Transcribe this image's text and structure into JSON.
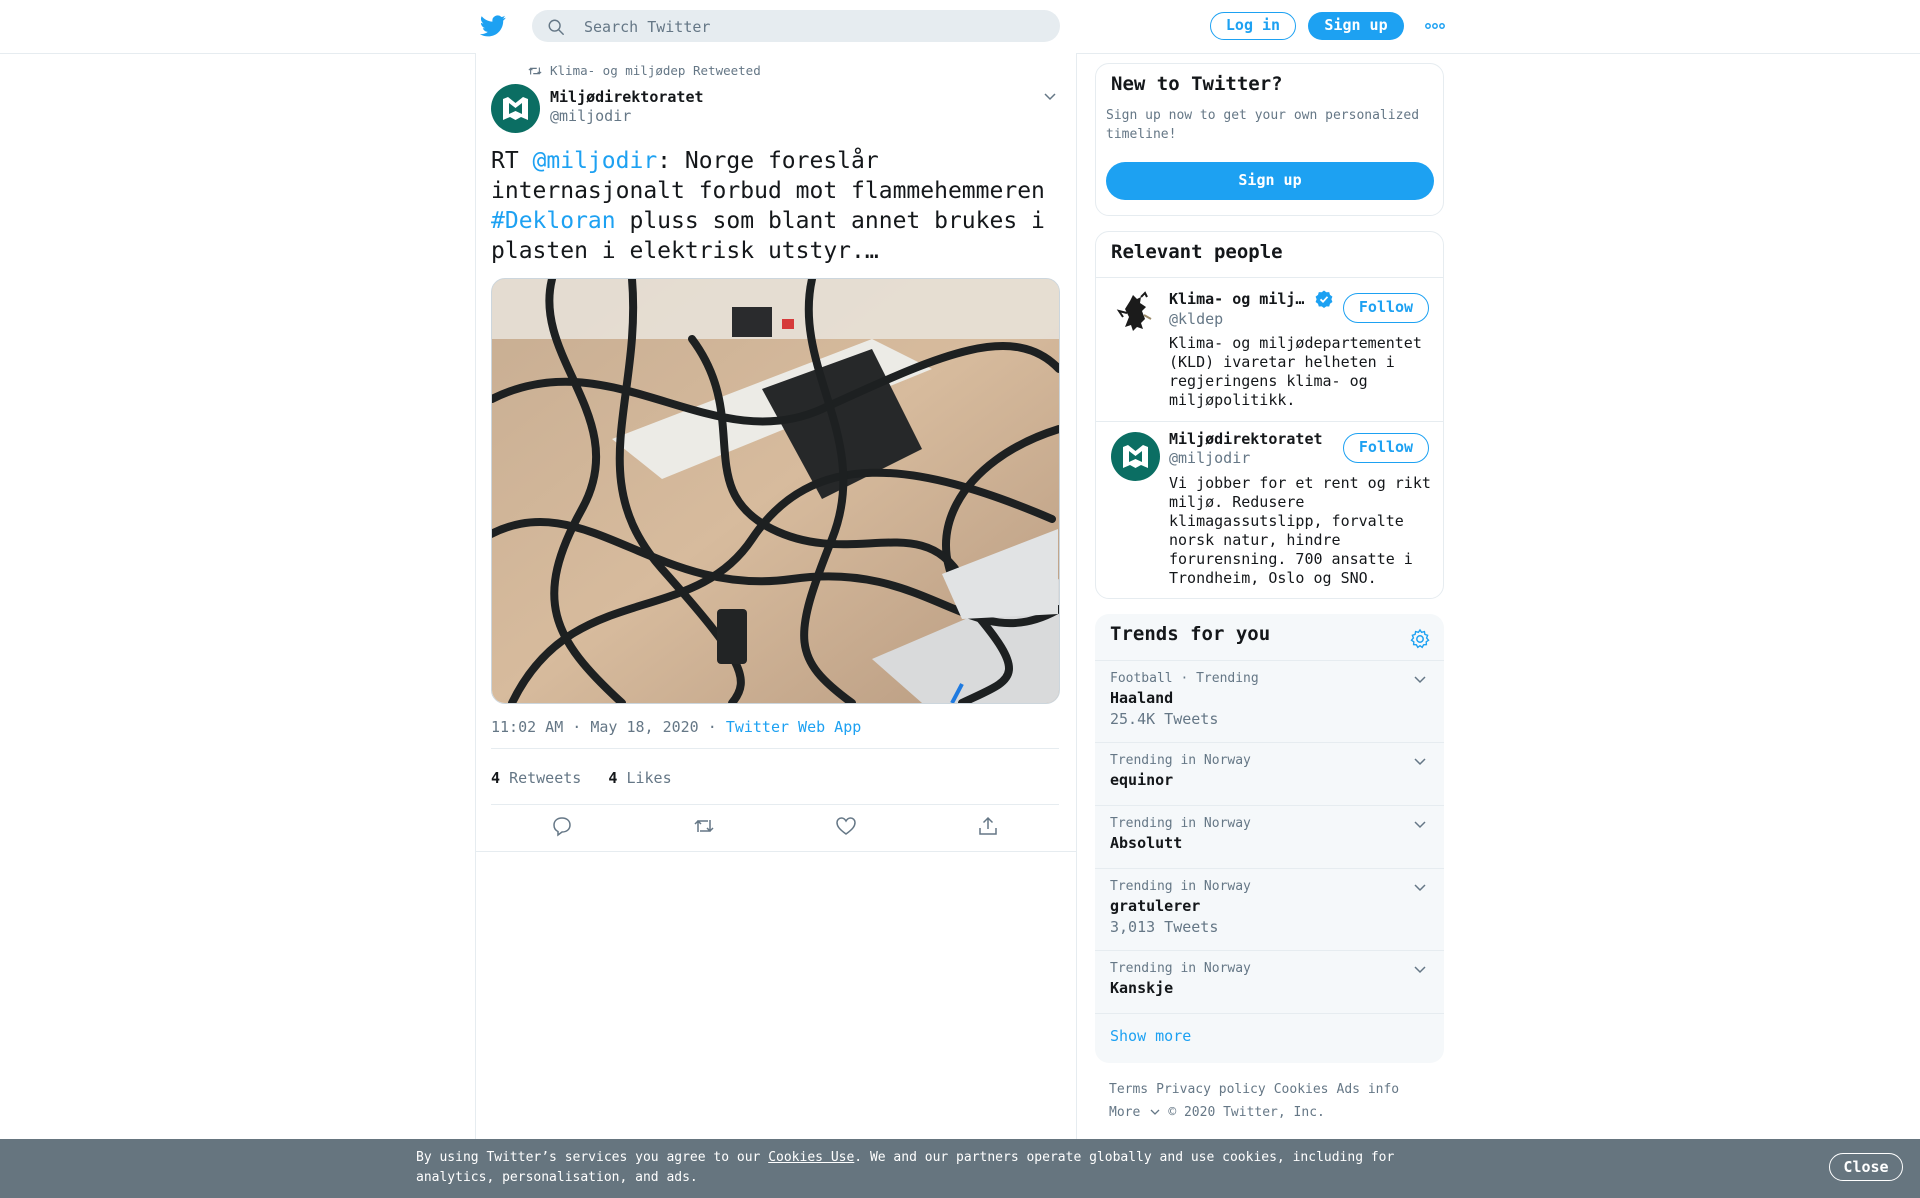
{
  "header": {
    "search_placeholder": "Search Twitter",
    "login_label": "Log in",
    "signup_label": "Sign up",
    "brand_color": "#1da1f2"
  },
  "tweet": {
    "retweeted_by": "Klima- og miljødep Retweeted",
    "author_name": "Miljødirektoratet",
    "author_handle": "@miljodir",
    "text_parts": {
      "prefix": "RT ",
      "mention": "@miljodir",
      "middle": ": Norge foreslår internasjonalt forbud mot flammehemmeren ",
      "hashtag": "#Dekloran",
      "suffix": " pluss som blant annet brukes i plasten i elektrisk utstyr.…"
    },
    "timestamp": "11:02 AM · May 18, 2020",
    "separator": "·",
    "source": "Twitter Web App",
    "retweet_count": "4",
    "retweets_label": "Retweets",
    "like_count": "4",
    "likes_label": "Likes",
    "actions": [
      "reply-icon",
      "retweet-icon",
      "like-icon",
      "share-icon"
    ]
  },
  "new_to_twitter": {
    "title": "New to Twitter?",
    "subtitle": "Sign up now to get your own personalized timeline!",
    "button": "Sign up"
  },
  "relevant_people": {
    "title": "Relevant people",
    "people": [
      {
        "name": "Klima- og milj…",
        "handle": "@kldep",
        "verified": true,
        "follow": "Follow",
        "bio": "Klima- og miljødepartementet (KLD) ivaretar helheten i regjeringens klima- og miljøpolitikk."
      },
      {
        "name": "Miljødirektoratet",
        "handle": "@miljodir",
        "verified": false,
        "follow": "Follow",
        "bio": "Vi jobber for et rent og rikt miljø. Redusere klimagassutslipp, forvalte norsk natur, hindre forurensning. 700 ansatte i Trondheim, Oslo og SNO."
      }
    ]
  },
  "trends": {
    "title": "Trends for you",
    "items": [
      {
        "context": "Football · Trending",
        "name": "Haaland",
        "count": "25.4K Tweets"
      },
      {
        "context": "Trending in Norway",
        "name": "equinor",
        "count": ""
      },
      {
        "context": "Trending in Norway",
        "name": "Absolutt",
        "count": ""
      },
      {
        "context": "Trending in Norway",
        "name": "gratulerer",
        "count": "3,013 Tweets"
      },
      {
        "context": "Trending in Norway",
        "name": "Kanskje",
        "count": ""
      }
    ],
    "show_more": "Show more"
  },
  "footer": {
    "terms": "Terms",
    "privacy": "Privacy policy",
    "cookies": "Cookies",
    "ads": "Ads info",
    "more": "More",
    "copyright": "© 2020 Twitter, Inc."
  },
  "cookie_bar": {
    "text_before": "By using Twitter’s services you agree to our ",
    "link": "Cookies Use",
    "text_after": ". We and our partners operate globally and use cookies, including for analytics, personalisation, and ads.",
    "close": "Close"
  }
}
